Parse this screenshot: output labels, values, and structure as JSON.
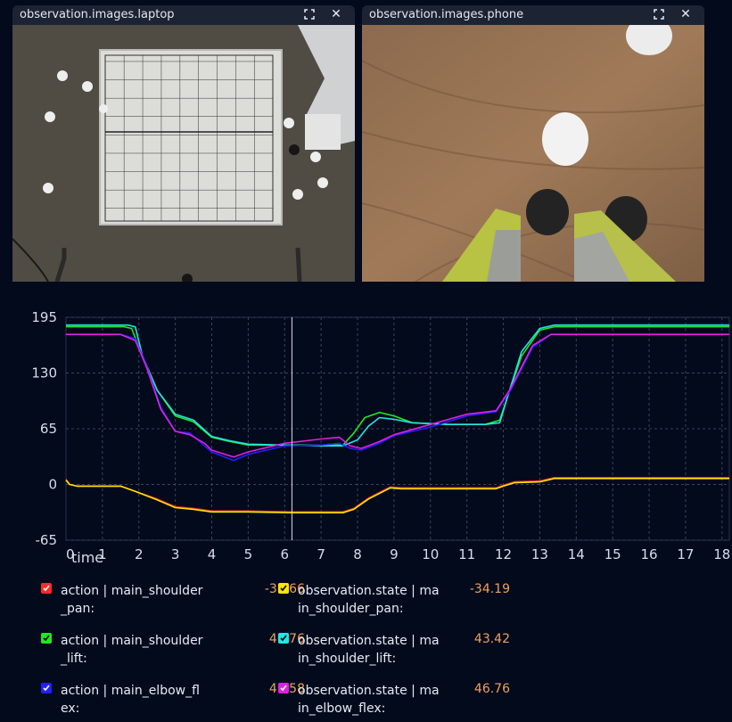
{
  "panels": [
    {
      "title": "observation.images.laptop",
      "maximize_icon": "maximize-icon",
      "close_icon": "close-icon",
      "close_glyph": "✕"
    },
    {
      "title": "observation.images.phone",
      "maximize_icon": "maximize-icon",
      "close_icon": "close-icon",
      "close_glyph": "✕"
    }
  ],
  "chart_data": {
    "type": "line",
    "xlabel": "time",
    "xlim": [
      0,
      18.2
    ],
    "ylim": [
      -65,
      195
    ],
    "yticks": [
      195,
      130,
      65,
      0,
      -65
    ],
    "xticks": [
      0,
      1,
      2,
      3,
      4,
      5,
      6,
      7,
      8,
      9,
      10,
      11,
      12,
      13,
      14,
      15,
      16,
      17,
      18
    ],
    "cursor_x": 6.2,
    "grid": true,
    "series": [
      {
        "name": "action | main_shoulder_pan:",
        "color": "#ff2a2a",
        "current": "-33.66",
        "x": [
          0,
          0.1,
          0.3,
          1.5,
          1.9,
          2.5,
          3.0,
          3.5,
          4.0,
          5.0,
          6.2,
          7.0,
          7.6,
          7.9,
          8.3,
          8.9,
          9.2,
          10.0,
          11.0,
          11.8,
          12.0,
          12.3,
          13.0,
          13.4,
          18.2
        ],
        "y": [
          6,
          0,
          -2,
          -2,
          -8,
          -17,
          -26,
          -28,
          -31,
          -31,
          -32,
          -32,
          -32,
          -28,
          -16,
          -3,
          -4,
          -4,
          -4,
          -4,
          -1,
          3,
          4,
          8,
          8
        ]
      },
      {
        "name": "observation.state | main_shoulder_pan:",
        "color": "#ffe500",
        "current": "-34.19",
        "x": [
          0,
          0.1,
          0.3,
          1.5,
          1.9,
          2.5,
          3.0,
          3.5,
          4.0,
          5.0,
          6.2,
          7.0,
          7.6,
          7.9,
          8.3,
          8.9,
          9.2,
          10.0,
          11.0,
          11.8,
          12.0,
          12.3,
          13.0,
          13.4,
          18.2
        ],
        "y": [
          5,
          0,
          -2,
          -2,
          -8,
          -18,
          -27,
          -29,
          -32,
          -32,
          -33,
          -33,
          -33,
          -29,
          -17,
          -4,
          -5,
          -5,
          -5,
          -5,
          -2,
          2,
          3,
          7,
          7
        ]
      },
      {
        "name": "action | main_shoulder_lift:",
        "color": "#22e822",
        "current": "46.76",
        "x": [
          0,
          1.6,
          1.8,
          2.1,
          2.5,
          3.0,
          3.5,
          4.0,
          4.5,
          5.0,
          6.0,
          7.0,
          7.6,
          7.9,
          8.2,
          8.6,
          9.0,
          9.5,
          10.5,
          11.5,
          11.9,
          12.1,
          12.5,
          13.0,
          13.4,
          18.2
        ],
        "y": [
          184,
          184,
          182,
          150,
          110,
          80,
          73,
          55,
          50,
          46,
          46,
          46,
          46,
          60,
          78,
          84,
          80,
          72,
          70,
          70,
          75,
          100,
          150,
          180,
          184,
          184
        ]
      },
      {
        "name": "observation.state | main_shoulder_lift:",
        "color": "#22e5e5",
        "current": "43.42",
        "x": [
          0,
          1.7,
          1.9,
          2.1,
          2.5,
          3.0,
          3.5,
          4.0,
          4.5,
          5.0,
          6.0,
          7.0,
          7.6,
          8.0,
          8.3,
          8.6,
          9.0,
          9.5,
          10.5,
          11.5,
          11.9,
          12.1,
          12.5,
          13.0,
          13.4,
          18.2
        ],
        "y": [
          186,
          186,
          184,
          150,
          110,
          82,
          75,
          56,
          51,
          47,
          46,
          45,
          45,
          52,
          68,
          78,
          76,
          72,
          70,
          70,
          72,
          100,
          155,
          182,
          186,
          186
        ]
      },
      {
        "name": "action | main_elbow_flex:",
        "color": "#2020ff",
        "current": "46.58",
        "x": [
          0,
          1.5,
          1.9,
          2.2,
          2.6,
          3.0,
          3.4,
          3.8,
          4.0,
          4.6,
          5.0,
          6.0,
          7.0,
          7.5,
          7.8,
          8.1,
          8.6,
          9.0,
          10.0,
          11.0,
          11.8,
          12.2,
          12.8,
          13.3,
          18.2
        ],
        "y": [
          175,
          175,
          170,
          140,
          90,
          62,
          60,
          45,
          38,
          28,
          35,
          45,
          46,
          48,
          42,
          40,
          48,
          57,
          67,
          80,
          85,
          110,
          160,
          175,
          175
        ]
      },
      {
        "name": "observation.state | main_elbow_flex:",
        "color": "#e020e0",
        "current": "46.76",
        "x": [
          0,
          1.5,
          1.9,
          2.2,
          2.6,
          3.0,
          3.4,
          3.8,
          4.0,
          4.6,
          5.0,
          6.0,
          7.0,
          7.5,
          7.8,
          8.1,
          8.6,
          9.0,
          10.0,
          11.0,
          11.8,
          12.2,
          12.8,
          13.3,
          18.2
        ],
        "y": [
          175,
          175,
          168,
          138,
          88,
          62,
          58,
          48,
          40,
          32,
          38,
          48,
          53,
          55,
          45,
          42,
          50,
          58,
          70,
          82,
          86,
          112,
          162,
          175,
          175
        ]
      }
    ]
  }
}
